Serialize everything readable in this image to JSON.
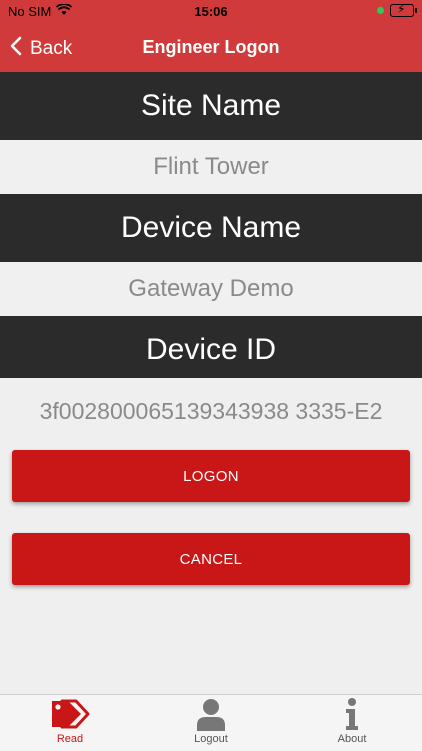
{
  "status_bar": {
    "carrier": "No SIM",
    "time": "15:06"
  },
  "nav": {
    "back_label": "Back",
    "title": "Engineer Logon"
  },
  "sections": {
    "site_name_header": "Site Name",
    "site_name_value": "Flint Tower",
    "device_name_header": "Device Name",
    "device_name_value": "Gateway Demo",
    "device_id_header": "Device ID",
    "device_id_value": "3f002800065139343938 3335-E2"
  },
  "buttons": {
    "logon": "LOGON",
    "cancel": "CANCEL"
  },
  "tabs": [
    {
      "label": "Read",
      "icon": "tags-icon",
      "active": true
    },
    {
      "label": "Logout",
      "icon": "person-icon",
      "active": false
    },
    {
      "label": "About",
      "icon": "info-icon",
      "active": false
    }
  ],
  "colors": {
    "accent_red": "#c91616",
    "nav_red": "#d03a3a",
    "header_dark": "#2b2b2b"
  }
}
